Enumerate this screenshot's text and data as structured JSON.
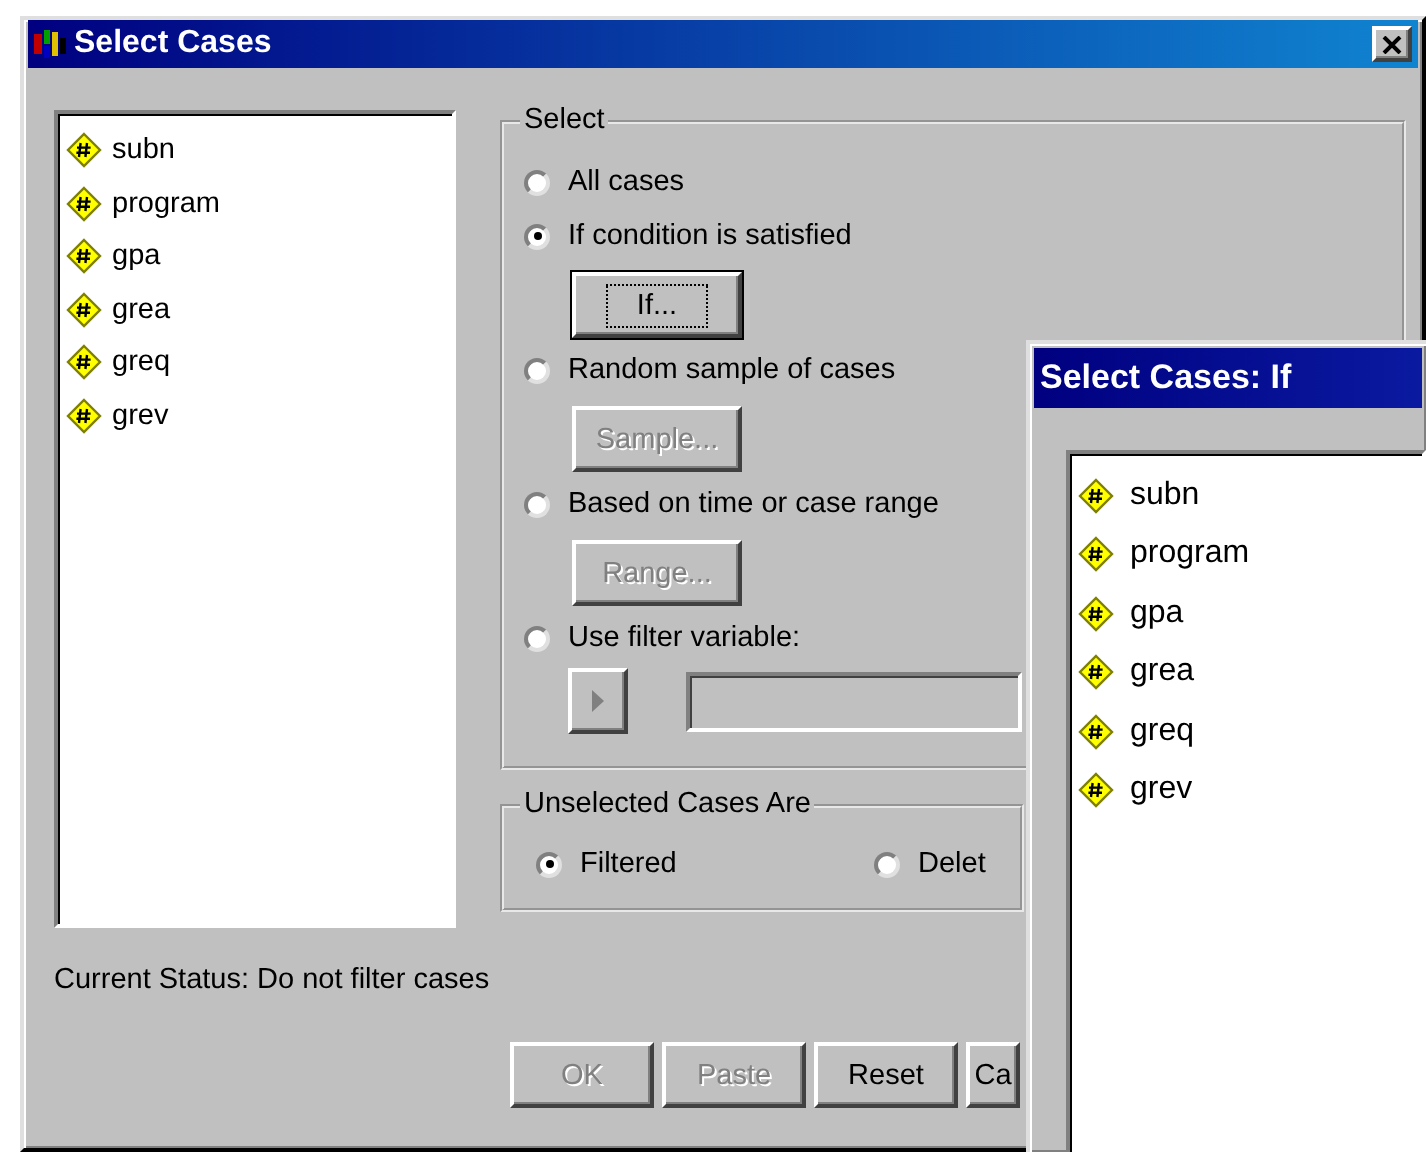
{
  "window": {
    "title": "Select Cases"
  },
  "variables": [
    "subn",
    "program",
    "gpa",
    "grea",
    "greq",
    "grev"
  ],
  "select_group": {
    "title": "Select",
    "options": [
      {
        "label": "All cases",
        "selected": false
      },
      {
        "label": "If condition is satisfied",
        "selected": true,
        "button": {
          "label": "If...",
          "disabled": false,
          "focused": true
        }
      },
      {
        "label": "Random sample of cases",
        "selected": false,
        "button": {
          "label": "Sample...",
          "disabled": true,
          "focused": false
        }
      },
      {
        "label": "Based on time or case range",
        "selected": false,
        "button": {
          "label": "Range...",
          "disabled": true,
          "focused": false
        }
      },
      {
        "label": "Use filter variable:",
        "selected": false
      }
    ],
    "filter_row": {
      "arrow_disabled": true
    }
  },
  "unselected_group": {
    "title": "Unselected Cases Are",
    "options": [
      {
        "label": "Filtered",
        "selected": true
      },
      {
        "label": "Delet",
        "selected": false
      }
    ]
  },
  "status": "Current Status: Do not filter cases",
  "buttons": [
    {
      "label": "OK",
      "disabled": true
    },
    {
      "label": "Paste",
      "disabled": true
    },
    {
      "label": "Reset",
      "disabled": false
    },
    {
      "label": "Ca",
      "disabled": false
    }
  ],
  "if_dialog": {
    "title": "Select Cases: If",
    "variables": [
      "subn",
      "program",
      "gpa",
      "grea",
      "greq",
      "grev"
    ]
  }
}
